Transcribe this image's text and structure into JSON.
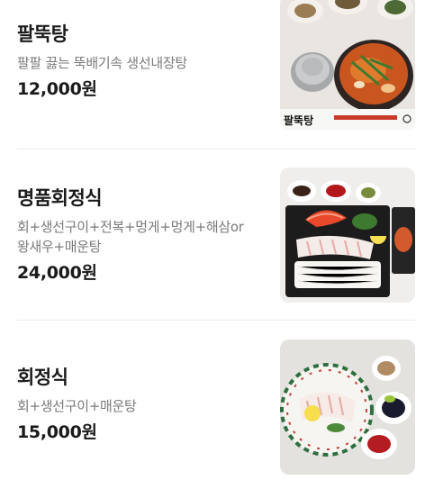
{
  "menu": {
    "items": [
      {
        "name": "팔뚝탕",
        "description": "팔팔 끓는 뚝배기속 생선내장탕",
        "price": "12,000원",
        "image_caption": "팔뚝탕",
        "image_icon": "stew-photo-icon"
      },
      {
        "name": "명품회정식",
        "description": "회+생선구이+전복+멍게+멍게+해삼or왕새우+매운탕",
        "price": "24,000원",
        "image_icon": "sashimi-platter-photo-icon"
      },
      {
        "name": "회정식",
        "description": "회+생선구이+매운탕",
        "price": "15,000원",
        "image_icon": "sashimi-plate-photo-icon"
      }
    ]
  },
  "colors": {
    "name_text": "#1a1a1a",
    "desc_text": "#7a7a7a",
    "divider": "#ececec"
  }
}
